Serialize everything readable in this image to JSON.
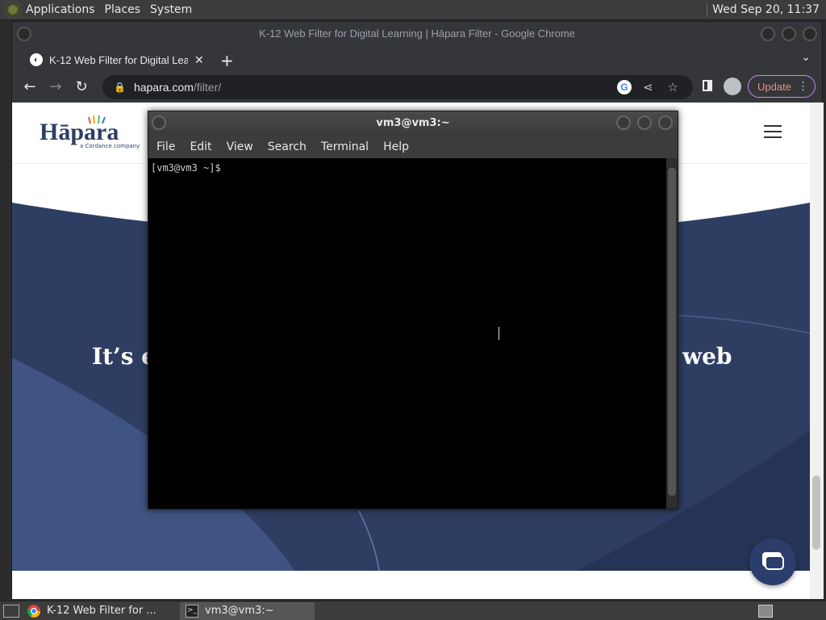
{
  "top_panel": {
    "menus": [
      "Applications",
      "Places",
      "System"
    ],
    "clock": "Wed Sep 20, 11:37"
  },
  "chrome": {
    "window_title": "K-12 Web Filter for Digital Learning | Hāpara Filter - Google Chrome",
    "tab_title": "K-12 Web Filter for Digital Lea",
    "url_host": "hapara.com",
    "url_path": "/filter/",
    "update_label": "Update"
  },
  "website": {
    "logo_text": "Hāpara",
    "logo_sub": "a Cordance company",
    "hero_left": "It’s ea",
    "hero_right": "web"
  },
  "terminal": {
    "title": "vm3@vm3:~",
    "menus": [
      "File",
      "Edit",
      "View",
      "Search",
      "Terminal",
      "Help"
    ],
    "prompt": "[vm3@vm3 ~]$ "
  },
  "taskbar": {
    "tasks": [
      "K-12 Web Filter for ...",
      "vm3@vm3:~"
    ]
  },
  "colors": {
    "hero_dark": "#2e3e63",
    "hero_mid": "#3f5482",
    "update_border": "#c58af9"
  }
}
